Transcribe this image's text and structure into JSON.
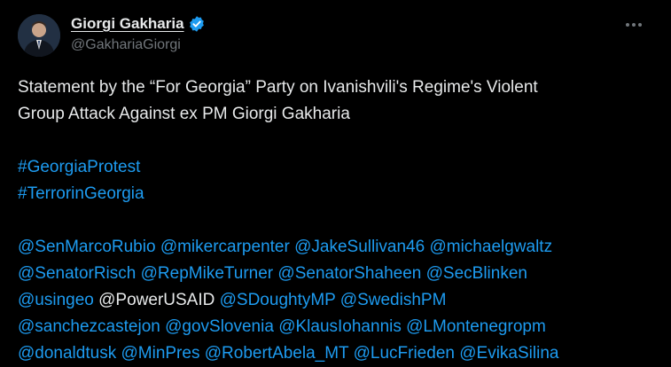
{
  "author": {
    "display_name": "Giorgi Gakharia",
    "handle": "@GakhariaGiorgi",
    "verified": true
  },
  "statement": {
    "line1": "Statement by the “For Georgia” Party on Ivanishvili's Regime's Violent",
    "line2": "Group Attack Against ex PM Giorgi Gakharia"
  },
  "hashtags": [
    "#GeorgiaProtest",
    "#TerrorinGeorgia"
  ],
  "mentions": {
    "row1": [
      "@SenMarcoRubio",
      "@mikercarpenter",
      "@JakeSullivan46",
      "@michaelgwaltz"
    ],
    "row2": [
      "@SenatorRisch",
      "@RepMikeTurner",
      "@SenatorShaheen",
      "@SecBlinken"
    ],
    "row3": [
      "@usingeo",
      "@PowerUSAID",
      "@SDoughtyMP",
      "@SwedishPM"
    ],
    "row4": [
      "@sanchezcastejon",
      "@govSlovenia",
      "@KlausIohannis",
      "@LMontenegropm"
    ],
    "row5": [
      "@donaldtusk",
      "@MinPres",
      "@RobertAbela_MT",
      "@LucFrieden",
      "@EvikaSilina"
    ]
  },
  "colors": {
    "background": "#000000",
    "text": "#e7e9ea",
    "link": "#1d9bf0",
    "secondary": "#71767b"
  },
  "icons": {
    "verified": "verified-badge-icon",
    "more": "more-options-icon"
  }
}
